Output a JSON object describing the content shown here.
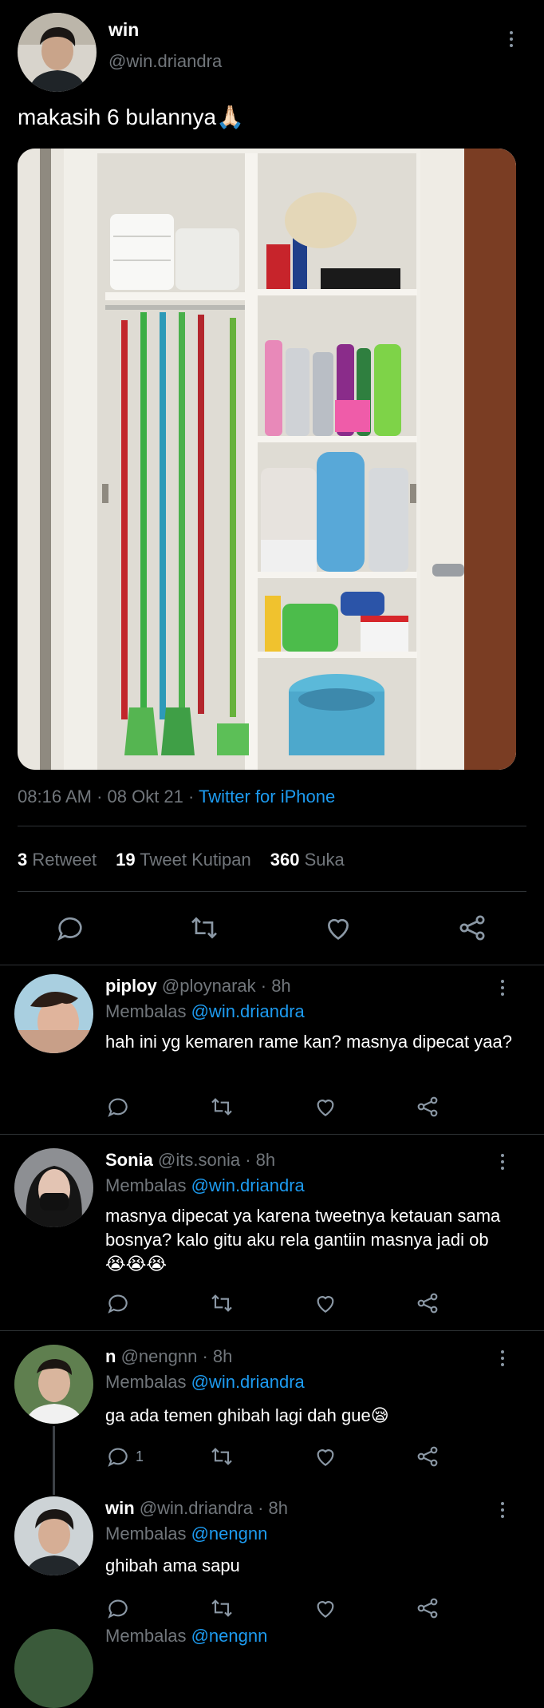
{
  "tweet": {
    "display_name": "win",
    "handle": "@win.driandra",
    "text": "makasih 6 bulannya🙏🏻",
    "time": "08:16 AM · 08 Okt 21 · ",
    "source": "Twitter for iPhone",
    "stats": {
      "retweets_count": "3",
      "retweets_label": "Retweet",
      "quotes_count": "19",
      "quotes_label": "Tweet Kutipan",
      "likes_count": "360",
      "likes_label": "Suka"
    }
  },
  "replies": [
    {
      "name": "piploy",
      "handle": "@ploynarak",
      "time": " · 8h",
      "replying_prefix": "Membalas ",
      "replying_to": "@win.driandra",
      "text": "hah ini yg kemaren rame kan? masnya dipecat yaa?",
      "reply_count": ""
    },
    {
      "name": "Sonia",
      "handle": "@its.sonia",
      "time": " · 8h",
      "replying_prefix": "Membalas ",
      "replying_to": "@win.driandra",
      "text": "masnya dipecat ya karena tweetnya ketauan sama bosnya? kalo gitu aku rela gantiin masnya jadi ob😭😭😭",
      "reply_count": ""
    },
    {
      "name": "n",
      "handle": "@nengnn",
      "time": " · 8h",
      "replying_prefix": "Membalas ",
      "replying_to": "@win.driandra",
      "text": "ga ada temen ghibah lagi dah gue😪",
      "reply_count": "1"
    },
    {
      "name": "win",
      "handle": "@win.driandra",
      "time": " · 8h",
      "replying_prefix": "Membalas ",
      "replying_to": "@nengnn",
      "text": "ghibah ama sapu",
      "reply_count": ""
    }
  ],
  "partial_reply": {
    "replying_prefix": "Membalas ",
    "replying_to": "@nengnn"
  },
  "colors": {
    "background": "#000000",
    "accent": "#1d9bf0",
    "muted": "#71767b",
    "divider": "#2f3336"
  }
}
